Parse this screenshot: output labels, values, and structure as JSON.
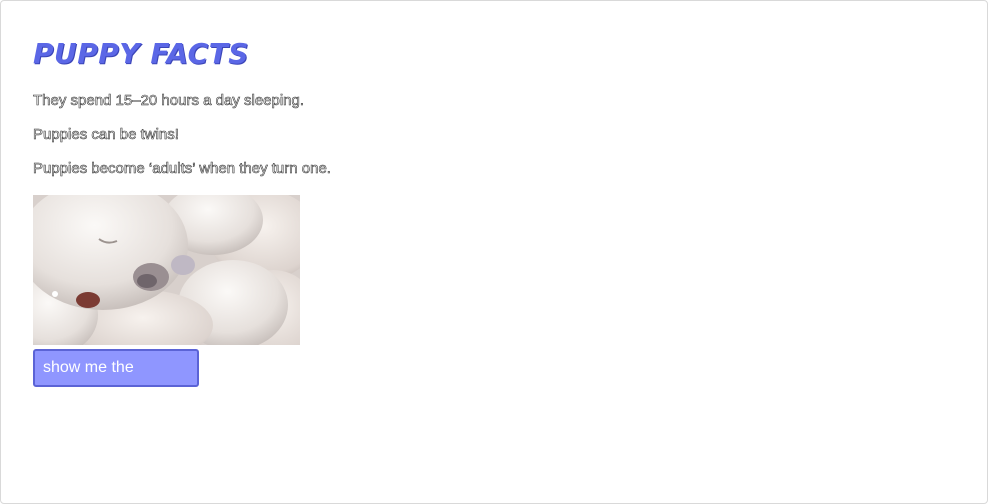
{
  "page": {
    "title": "PUPPY FACTS"
  },
  "facts": [
    "They spend 15–20 hours a day sleeping.",
    "Puppies can be twins!",
    "Puppies become ‘adults’ when they turn one."
  ],
  "image": {
    "subject": "sleeping white puppies photo"
  },
  "actions": {
    "reveal_label": "show me the secrets!"
  },
  "colors": {
    "title": "#5b67e6",
    "button_bg": "#8f96ff",
    "button_border": "#5b63d6"
  }
}
